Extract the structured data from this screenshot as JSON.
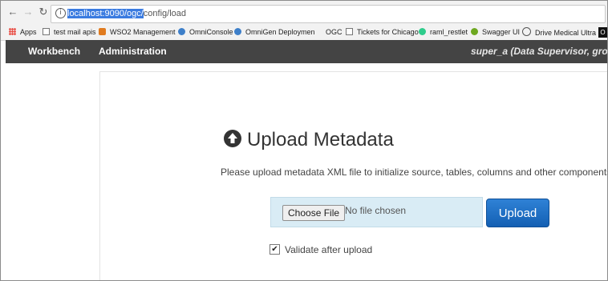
{
  "browser": {
    "url_host": "localhost:9090/ogc/",
    "url_path": "config/load",
    "nav": {
      "back": "←",
      "forward": "→",
      "reload": "↻"
    },
    "info_icon": "i"
  },
  "bookmarks": [
    {
      "label": "Apps",
      "icon": "apps-grid-icon"
    },
    {
      "label": "test mail apis",
      "icon": "page-icon"
    },
    {
      "label": "WSO2 Management",
      "icon": "wso2-icon"
    },
    {
      "label": "OmniConsole",
      "icon": "globe-icon"
    },
    {
      "label": "OmniGen Deploymen",
      "icon": "globe-icon"
    },
    {
      "label": "OGC",
      "icon": ""
    },
    {
      "label": "Tickets for Chicago",
      "icon": "page-icon"
    },
    {
      "label": "raml_restlet",
      "icon": "raml-icon"
    },
    {
      "label": "Swagger UI",
      "icon": "swagger-icon"
    },
    {
      "label": "Drive Medical Ultra Li",
      "icon": "drive-icon"
    },
    {
      "label": "O",
      "icon": ""
    }
  ],
  "appnav": {
    "workbench": "Workbench",
    "administration": "Administration",
    "user": "super_a (Data Supervisor, group.c"
  },
  "upload": {
    "title": "Upload Metadata",
    "subtitle": "Please upload metadata XML file to initialize source, tables, columns and other components.",
    "choose_button": "Choose File",
    "no_file": "No file chosen",
    "upload_button": "Upload",
    "validate_label": "Validate after upload",
    "validate_checked": true,
    "check_mark": "✔"
  }
}
